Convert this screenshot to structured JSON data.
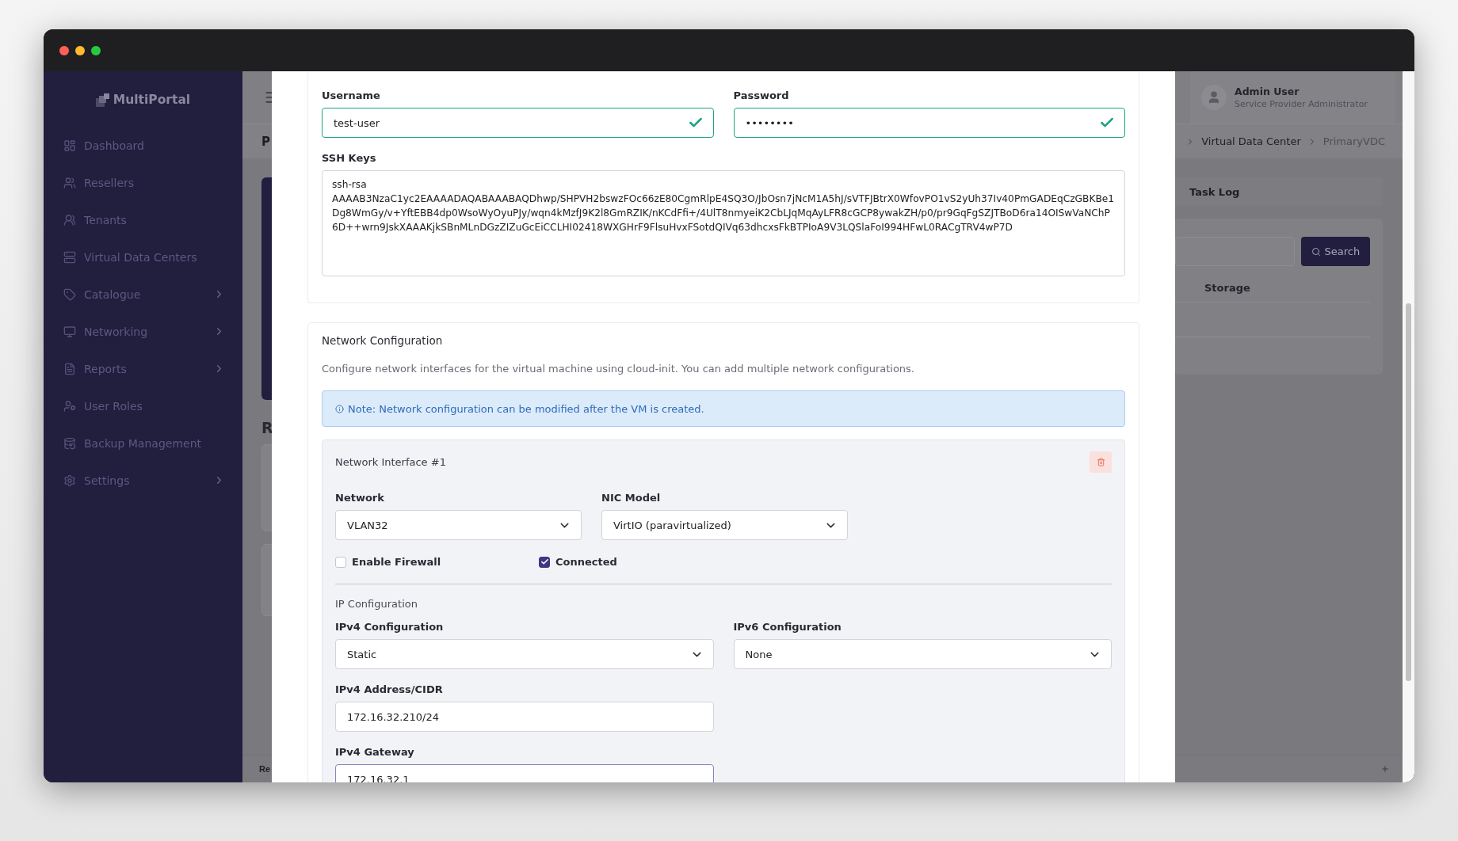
{
  "sidebar": {
    "logo": "MultiPortal",
    "items": [
      {
        "label": "Dashboard",
        "expandable": false
      },
      {
        "label": "Resellers",
        "expandable": false
      },
      {
        "label": "Tenants",
        "expandable": false
      },
      {
        "label": "Virtual Data Centers",
        "expandable": false
      },
      {
        "label": "Catalogue",
        "expandable": true
      },
      {
        "label": "Networking",
        "expandable": true
      },
      {
        "label": "Reports",
        "expandable": true
      },
      {
        "label": "User Roles",
        "expandable": false
      },
      {
        "label": "Backup Management",
        "expandable": false
      },
      {
        "label": "Settings",
        "expandable": true
      }
    ]
  },
  "header": {
    "user": {
      "name": "Admin User",
      "role": "Service Provider Administrator"
    }
  },
  "breadcrumb": {
    "page_title": "P",
    "crumbs": [
      "Virtual Data Center",
      "PrimaryVDC"
    ]
  },
  "page": {
    "section_heading": "R",
    "tab": "Task Log",
    "search_button": "Search",
    "columns": [
      "Storage"
    ],
    "footer_text": "Re"
  },
  "form": {
    "username": {
      "label": "Username",
      "value": "test-user",
      "valid": true
    },
    "password": {
      "label": "Password",
      "value": "••••••••",
      "valid": true
    },
    "ssh_keys": {
      "label": "SSH Keys",
      "value": "ssh-rsa\nAAAAB3NzaC1yc2EAAAADAQABAAABAQDhwp/SHPVH2bswzFOc66zE80CgmRlpE4SQ3O/JbOsn7jNcM1A5hJ/sVTFJBtrX0WfovPO1vS2yUh37Iv40PmGADEqCzGBKBe1Dg8WmGy/v+YftEBB4dp0WsoWyOyuPJy/wqn4kMzfJ9K2l8GmRZIK/nKCdFfi+/4UlT8nmyeiK2CbLJqMqAyLFR8cGCP8ywakZH/p0/pr9GqFgSZJTBoD6ra14OISwVaNChP6D++wrn9JskXAAAKjkSBnMLnDGzZIZuGcEiCCLHI02418WXGHrF9FlsuHvxFSotdQIVq63dhcxsFkBTPIoA9V3LQSlaFoI994HFwL0RACgTRV4wP7D"
    },
    "network": {
      "title": "Network Configuration",
      "description": "Configure network interfaces for the virtual machine using cloud-init. You can add multiple network configurations.",
      "note": "Note: Network configuration can be modified after the VM is created.",
      "interfaces": [
        {
          "title": "Network Interface #1",
          "network": {
            "label": "Network",
            "value": "VLAN32"
          },
          "nic_model": {
            "label": "NIC Model",
            "value": "VirtIO (paravirtualized)"
          },
          "options": [
            {
              "label": "Enable Firewall",
              "checked": false
            },
            {
              "label": "Connected",
              "checked": true
            }
          ],
          "ip_title": "IP Configuration",
          "ipv4_mode": {
            "label": "IPv4 Configuration",
            "value": "Static"
          },
          "ipv6_mode": {
            "label": "IPv6 Configuration",
            "value": "None"
          },
          "ipv4_address": {
            "label": "IPv4 Address/CIDR",
            "value": "172.16.32.210/24",
            "focused": false
          },
          "ipv4_gateway": {
            "label": "IPv4 Gateway",
            "value": "172.16.32.1",
            "focused": true
          }
        }
      ]
    }
  }
}
